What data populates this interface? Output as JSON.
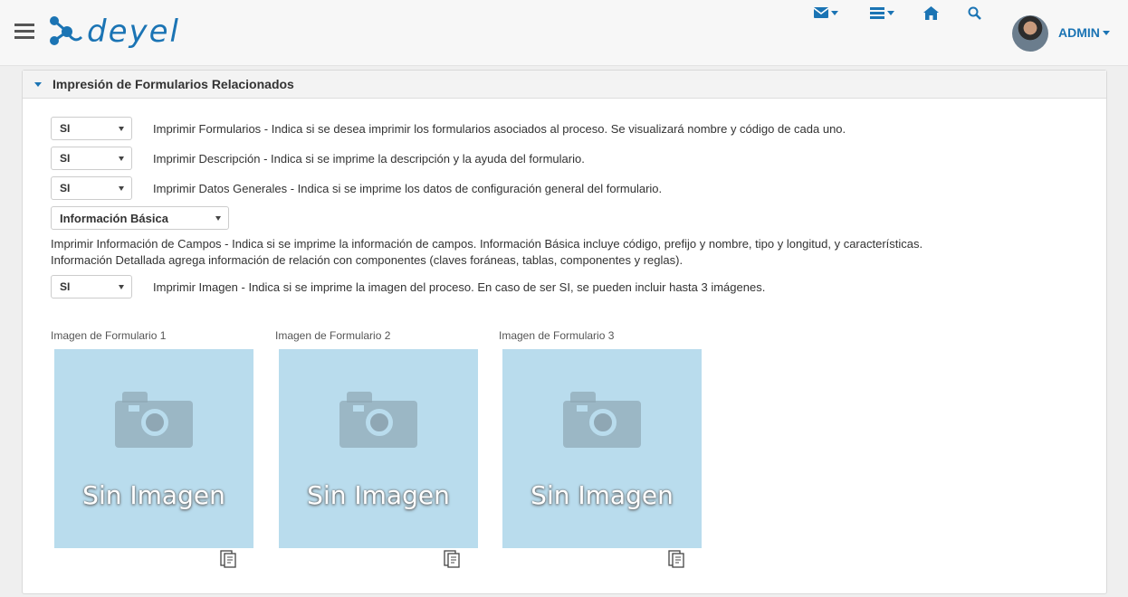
{
  "header": {
    "logo_text": "deyel",
    "user_label": "ADMIN",
    "icons": [
      "menu-icon",
      "mail-icon",
      "list-icon",
      "home-icon",
      "search-icon"
    ]
  },
  "colors": {
    "accent": "#1b74b4",
    "image_placeholder": "#b9dced"
  },
  "section": {
    "title": "Impresión de Formularios Relacionados",
    "options": [
      {
        "value": "SI",
        "text": "Imprimir Formularios - Indica si se desea imprimir los formularios asociados al proceso. Se visualizará nombre y código de cada uno."
      },
      {
        "value": "SI",
        "text": "Imprimir Descripción - Indica si se imprime la descripción y la ayuda del formulario."
      },
      {
        "value": "SI",
        "text": "Imprimir Datos Generales - Indica si se imprime los datos de configuración general del formulario."
      }
    ],
    "fields_select": {
      "value": "Información Básica"
    },
    "fields_text_1": "Imprimir Información de Campos - Indica si se imprime la información de campos. Información Básica incluye código, prefijo y nombre, tipo y longitud, y características.",
    "fields_text_2": "Información Detallada agrega información de relación con componentes (claves foráneas, tablas, componentes y reglas).",
    "image_option": {
      "value": "SI",
      "text": "Imprimir Imagen - Indica si se imprime la imagen del proceso. En caso de ser SI, se pueden incluir hasta 3 imágenes."
    },
    "images": [
      {
        "label": "Imagen de Formulario 1",
        "placeholder": "Sin Imagen"
      },
      {
        "label": "Imagen de Formulario 2",
        "placeholder": "Sin Imagen"
      },
      {
        "label": "Imagen de Formulario 3",
        "placeholder": "Sin Imagen"
      }
    ]
  }
}
